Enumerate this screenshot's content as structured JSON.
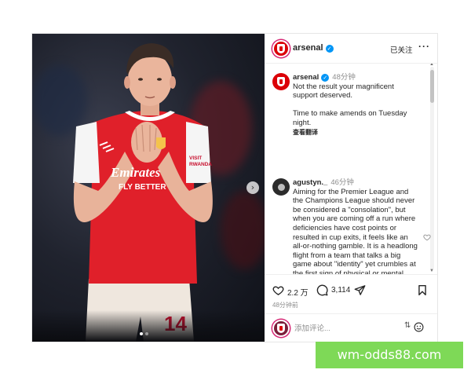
{
  "post": {
    "account": "arsenal",
    "follow_status": "已关注",
    "more_label": "···",
    "verified_mark": "✓",
    "photo": {
      "description_icon": "player-photo",
      "sponsor_text": "Emirates",
      "sponsor_text_2": "FLY BETTER",
      "sleeve_text": "VISIT RWANDA",
      "shirt_number": "14",
      "carousel_next": "›",
      "slide_count": 2,
      "active_slide": 1
    },
    "caption": {
      "username": "arsenal",
      "time": "48分钟",
      "line1": "Not the result your magnificent support deserved.",
      "line2": "Time to make amends on Tuesday night.",
      "translate": "查看翻译"
    },
    "comment": {
      "username": "agustyn._",
      "time": "46分钟",
      "text": "Aiming for the Premier League and the Champions League should never be considered a \"consolation\", but when you are coming off a run where deficiencies have cost points or resulted in cup exits, it feels like an all-or-nothing gamble. It is a headlong flight from a team that talks a big game about \"identity\" yet crumbles at the first sign of physical or mental resistance."
    },
    "actions": {
      "likes": "2.2 万",
      "comments": "3,114",
      "posted": "48分钟前"
    },
    "composer": {
      "placeholder": "添加评论...",
      "sort_icon": "⇅"
    }
  },
  "watermark": "wm-odds88.com",
  "colors": {
    "brand_red": "#db0007",
    "verified_blue": "#0095f6",
    "watermark_green": "#7ed957"
  }
}
